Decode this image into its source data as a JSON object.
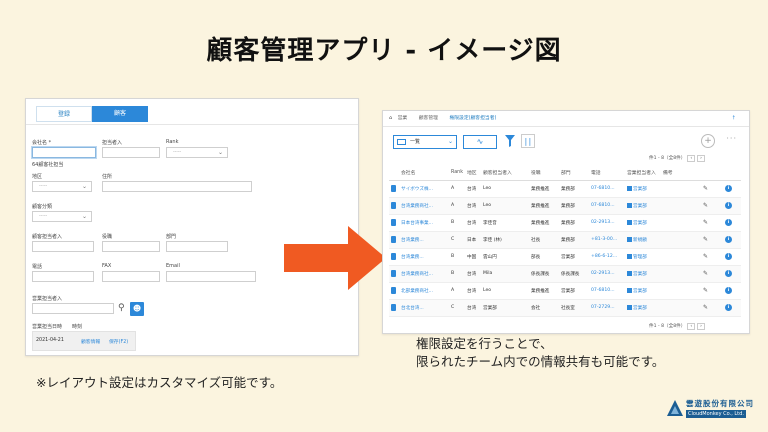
{
  "title": "顧客管理アプリ - イメージ図",
  "form": {
    "tabs": [
      "登録",
      "顧客"
    ],
    "fields": {
      "company_name": "会社名 *",
      "contact_input": "担当者入",
      "rank": "Rank",
      "rank_placeholder": "-----",
      "owner_note": "64顧客社担当",
      "area": "地区",
      "address": "住所",
      "area_placeholder": "-----",
      "status": "顧客分類",
      "status_placeholder": "-----",
      "person_in_charge": "顧客担当者入",
      "position": "役職",
      "department": "部門",
      "tel": "電話",
      "fax": "FAX",
      "email": "Email",
      "sales_rep": "営業担当者入",
      "date_label": "営業担当日時",
      "time_label": "時刻",
      "date_value": "2021-04-21",
      "cancel_link": "顧客情報",
      "save_link": "保存(F2)"
    }
  },
  "list": {
    "breadcrumbs": [
      "営業",
      "顧客管理",
      "権限設定(顧客担当者)"
    ],
    "view_name": "一覧",
    "pager": "件1 - 8（全8件）",
    "columns": [
      "",
      "会社名",
      "Rank",
      "地区",
      "顧客担当者入",
      "役職",
      "部門",
      "電話",
      "営業担当者入",
      "備考",
      "",
      ""
    ],
    "rows": [
      [
        "サイボウズ株...",
        "A",
        "台湾",
        "Leo",
        "業務推進",
        "業務部",
        "07-6810...",
        "営業部"
      ],
      [
        "台湾業務商社...",
        "A",
        "台湾",
        "Leo",
        "業務推進",
        "業務部",
        "07-6810...",
        "営業部"
      ],
      [
        "日本台湾事業...",
        "B",
        "台湾",
        "李佳音",
        "業務推進",
        "業務部",
        "02-2913...",
        "営業部"
      ],
      [
        "台湾業務...",
        "C",
        "日本",
        "李佳 (林)",
        "社長",
        "業務部",
        "+81-3-00...",
        "新規顧"
      ],
      [
        "台湾業務...",
        "B",
        "中国",
        "雲山円",
        "部長",
        "営業部",
        "+86-6-12...",
        "管理部"
      ],
      [
        "台湾業務商社...",
        "B",
        "台湾",
        "Mila",
        "係長課長",
        "係長課長",
        "02-2913...",
        "営業部"
      ],
      [
        "北部業務商社...",
        "A",
        "台湾",
        "Leo",
        "業務推進",
        "営業部",
        "07-6810...",
        "営業部"
      ],
      [
        "台北台湾...",
        "C",
        "台湾",
        "営業部",
        "会社",
        "社長室",
        "07-2729...",
        "営業部"
      ]
    ],
    "pager_bottom": "件1 - 8（全8件）"
  },
  "captions": {
    "right_line1": "権限設定を行うことで、",
    "right_line2": "限られたチーム内での情報共有も可能です。",
    "left": "※レイアウト設定はカスタマイズ可能です。"
  },
  "logo": {
    "name": "雲遊股份有限公司",
    "sub": "CloudMonkey Co., Ltd."
  }
}
